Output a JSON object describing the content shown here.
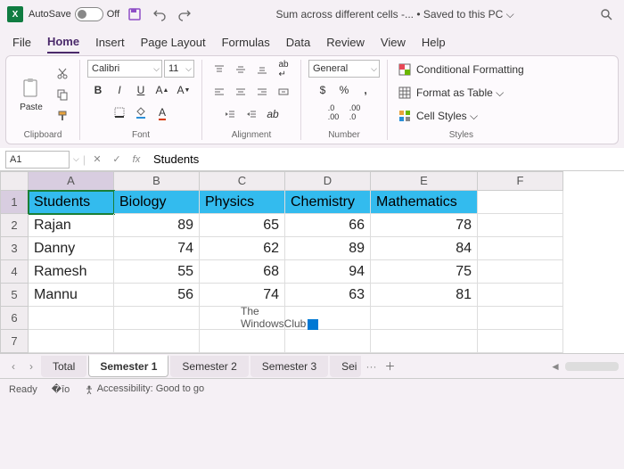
{
  "titlebar": {
    "autosave_label": "AutoSave",
    "autosave_state": "Off",
    "doc_title": "Sum across different cells -... • Saved to this PC ⌵"
  },
  "tabs": [
    "File",
    "Home",
    "Insert",
    "Page Layout",
    "Formulas",
    "Data",
    "Review",
    "View",
    "Help"
  ],
  "active_tab": "Home",
  "ribbon": {
    "clipboard": {
      "label": "Clipboard",
      "paste": "Paste"
    },
    "font": {
      "label": "Font",
      "name": "Calibri",
      "size": "11"
    },
    "alignment": {
      "label": "Alignment"
    },
    "number": {
      "label": "Number",
      "format": "General"
    },
    "styles": {
      "label": "Styles",
      "cond": "Conditional Formatting",
      "table": "Format as Table ⌵",
      "cell": "Cell Styles ⌵"
    }
  },
  "formula_bar": {
    "name_box": "A1",
    "formula": "Students"
  },
  "columns": [
    "A",
    "B",
    "C",
    "D",
    "E",
    "F"
  ],
  "rows": [
    "1",
    "2",
    "3",
    "4",
    "5",
    "6",
    "7"
  ],
  "headers": [
    "Students",
    "Biology",
    "Physics",
    "Chemistry",
    "Mathematics"
  ],
  "data": [
    [
      "Rajan",
      "89",
      "65",
      "66",
      "78"
    ],
    [
      "Danny",
      "74",
      "62",
      "89",
      "84"
    ],
    [
      "Ramesh",
      "55",
      "68",
      "94",
      "75"
    ],
    [
      "Mannu",
      "56",
      "74",
      "63",
      "81"
    ]
  ],
  "watermark": {
    "line1": "The",
    "line2": "WindowsClub"
  },
  "sheets": [
    "Total",
    "Semester 1",
    "Semester 2",
    "Semester 3",
    "Sei"
  ],
  "active_sheet": "Semester 1",
  "sheet_overflow": "···",
  "status": {
    "ready": "Ready",
    "access": "Accessibility: Good to go"
  },
  "chart_data": {
    "type": "table",
    "columns": [
      "Students",
      "Biology",
      "Physics",
      "Chemistry",
      "Mathematics"
    ],
    "rows": [
      {
        "Students": "Rajan",
        "Biology": 89,
        "Physics": 65,
        "Chemistry": 66,
        "Mathematics": 78
      },
      {
        "Students": "Danny",
        "Biology": 74,
        "Physics": 62,
        "Chemistry": 89,
        "Mathematics": 84
      },
      {
        "Students": "Ramesh",
        "Biology": 55,
        "Physics": 68,
        "Chemistry": 94,
        "Mathematics": 75
      },
      {
        "Students": "Mannu",
        "Biology": 56,
        "Physics": 74,
        "Chemistry": 63,
        "Mathematics": 81
      }
    ]
  }
}
